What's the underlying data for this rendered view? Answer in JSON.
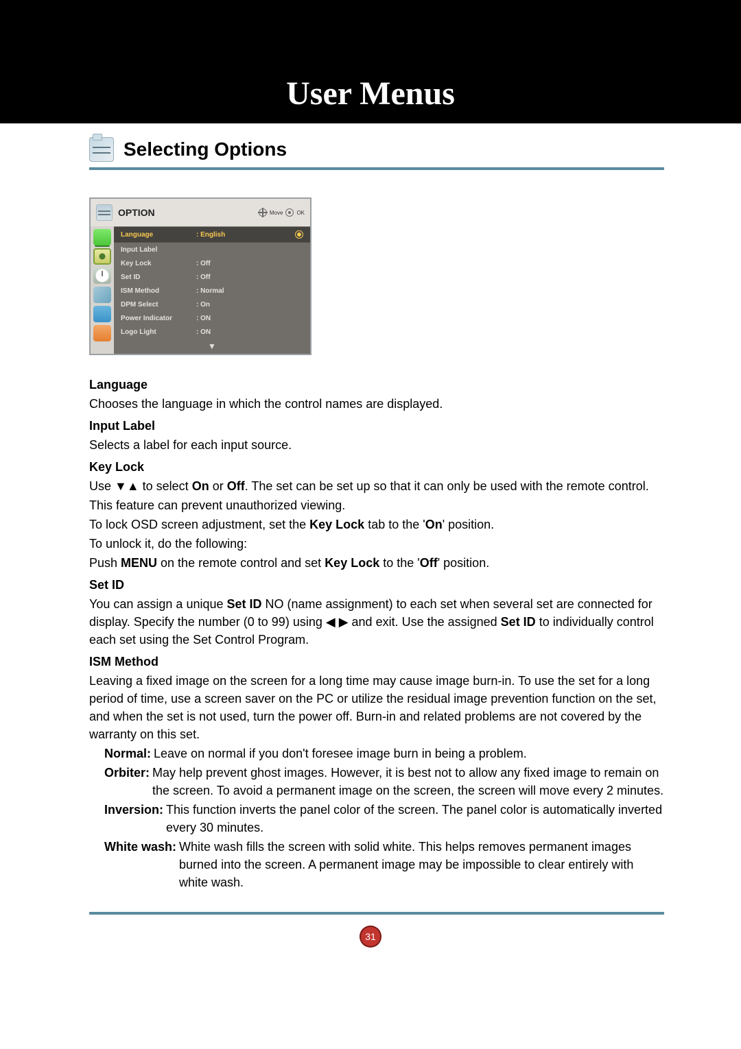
{
  "title": "User Menus",
  "section_title": "Selecting Options",
  "osd": {
    "title": "OPTION",
    "move_label": "Move",
    "ok_label": "OK",
    "down_arrow": "▼",
    "items": [
      {
        "label": "Language",
        "value": ": English",
        "selected": true
      },
      {
        "label": "Input Label",
        "value": "",
        "selected": false
      },
      {
        "label": "Key Lock",
        "value": ": Off",
        "selected": false
      },
      {
        "label": "Set ID",
        "value": ": Off",
        "selected": false
      },
      {
        "label": "ISM Method",
        "value": ": Normal",
        "selected": false
      },
      {
        "label": "DPM Select",
        "value": ": On",
        "selected": false
      },
      {
        "label": "Power Indicator",
        "value": ": ON",
        "selected": false
      },
      {
        "label": "Logo Light",
        "value": ": ON",
        "selected": false
      }
    ]
  },
  "body": {
    "language_term": "Language",
    "language_desc": "Chooses the language in which the control names are displayed.",
    "input_label_term": "Input Label",
    "input_label_desc": "Selects a label for each input source.",
    "keylock_term": "Key Lock",
    "keylock_p1_a": "Use ▼▲ to select ",
    "keylock_p1_on": "On",
    "keylock_p1_b": " or ",
    "keylock_p1_off": "Off",
    "keylock_p1_c": ". The set can be set up so that it can only be used with the remote control.",
    "keylock_p2": "This feature can prevent unauthorized viewing.",
    "keylock_p3_a": "To lock OSD screen adjustment, set the ",
    "keylock_p3_b": "Key Lock",
    "keylock_p3_c": " tab to the '",
    "keylock_p3_on": "On",
    "keylock_p3_d": "' position.",
    "keylock_p4": "To unlock it, do the following:",
    "keylock_p5_a": "Push ",
    "keylock_p5_menu": "MENU",
    "keylock_p5_b": " on the remote control and set ",
    "keylock_p5_kl": "Key Lock",
    "keylock_p5_c": " to the '",
    "keylock_p5_off": "Off",
    "keylock_p5_d": "' position.",
    "setid_term": "Set ID",
    "setid_p1_a": "You can assign a unique ",
    "setid_p1_b": "Set ID",
    "setid_p1_c": " NO (name assignment) to each set when several set are connected for display. Specify the number (0 to 99) using ◀ ▶ and exit. Use the assigned ",
    "setid_p1_d": "Set ID",
    "setid_p1_e": " to individually control each set using the Set Control Program.",
    "ism_term": "ISM Method",
    "ism_intro": "Leaving a fixed image on the screen for a long time may cause image burn-in. To use the set for a long period of time, use a screen saver on the PC or utilize the residual image prevention function on the set, and when the set is not used, turn the power off. Burn-in and related problems are not covered by the warranty on this set.",
    "ism_items": [
      {
        "label": "Normal: ",
        "desc": "Leave on normal if you don't foresee image burn in being a problem."
      },
      {
        "label": "Orbiter: ",
        "desc": "May help prevent ghost images. However, it is best not to allow any fixed image to remain on the screen. To avoid a permanent image on the screen, the screen will move every 2 minutes."
      },
      {
        "label": "Inversion: ",
        "desc": "This function inverts the panel color of the screen. The panel color is automatically inverted every 30 minutes."
      },
      {
        "label": "White wash: ",
        "desc": "White wash fills the screen with solid white. This helps removes permanent images burned into the screen. A permanent image may be impossible to clear entirely with white wash."
      }
    ]
  },
  "page_number": "31"
}
